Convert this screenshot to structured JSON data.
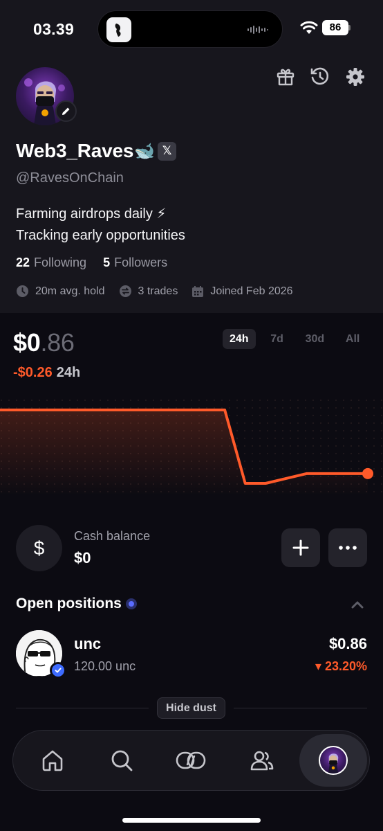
{
  "status_bar": {
    "time": "03.39",
    "battery": "86"
  },
  "profile": {
    "username": "Web3_Raves",
    "username_emoji": "🐋",
    "x_badge": "𝕏",
    "handle": "@RavesOnChain",
    "bio": [
      "Farming airdrops daily ⚡",
      "Tracking early opportunities"
    ],
    "following_count": "22",
    "following_label": "Following",
    "followers_count": "5",
    "followers_label": "Followers",
    "stats": {
      "avg_hold": "20m avg. hold",
      "trades": "3 trades",
      "joined": "Joined Feb 2026"
    },
    "icons": [
      "gift-icon",
      "history-icon",
      "settings-icon"
    ]
  },
  "portfolio": {
    "value_whole": "$0",
    "value_cents": ".86",
    "change": "-$0.26",
    "change_period": "24h",
    "ranges": [
      "24h",
      "7d",
      "30d",
      "All"
    ],
    "active_range": "24h",
    "line_color": "#ff5a2a"
  },
  "chart_data": {
    "type": "line",
    "series": [
      {
        "values": [
          1.12,
          1.12,
          1.12,
          1.12,
          1.12,
          1.12,
          1.12,
          1.12,
          1.12,
          1.12,
          1.12,
          1.12,
          0.82,
          0.82,
          0.84,
          0.86,
          0.86,
          0.86,
          0.86
        ]
      }
    ],
    "color": "#ff5a2a"
  },
  "cash": {
    "label": "Cash balance",
    "value": "$0",
    "icon": "$"
  },
  "positions": {
    "title": "Open positions",
    "items": [
      {
        "name": "unc",
        "quantity": "120.00 unc",
        "value": "$0.86",
        "change": "▾ 23.20%"
      }
    ],
    "hide_dust_label": "Hide dust"
  },
  "nav": {
    "items": [
      "home-icon",
      "search-icon",
      "trade-icon",
      "community-icon",
      "profile-avatar"
    ],
    "active": "profile-avatar"
  }
}
